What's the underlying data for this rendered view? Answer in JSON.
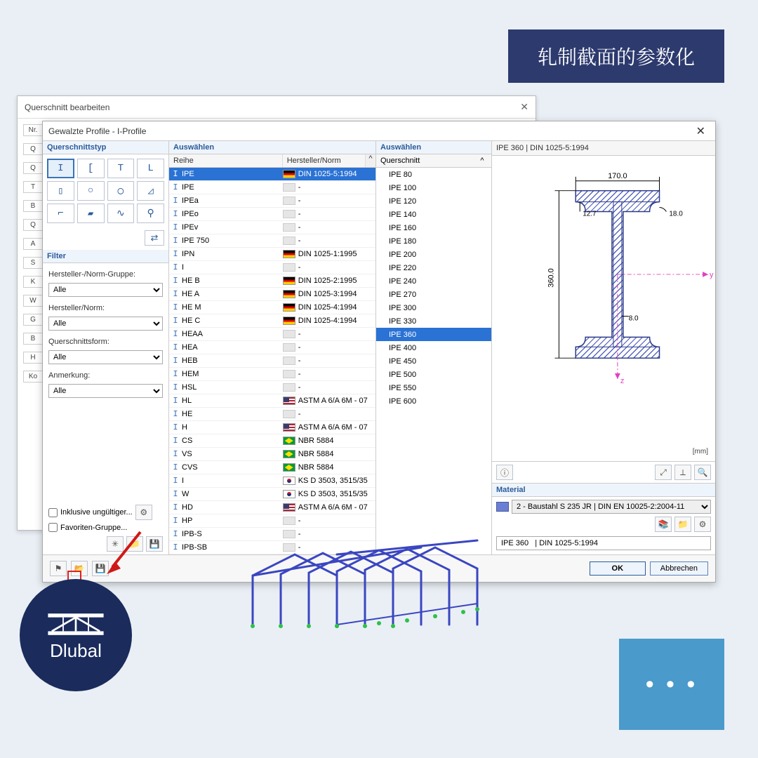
{
  "banner": {
    "text": "轧制截面的参数化"
  },
  "dialog1": {
    "title": "Querschnitt bearbeiten",
    "stubs": [
      "Nr.",
      "Q",
      "Q",
      "T",
      "B",
      "Q",
      "A",
      "S",
      "K",
      "W",
      "G",
      "B",
      "H",
      "Ko"
    ]
  },
  "dialog2": {
    "title": "Gewalzte Profile - I-Profile",
    "left": {
      "type_label": "Querschnittstyp",
      "types": [
        "I",
        "[",
        "T",
        "L",
        "▯",
        "○",
        "◯",
        "◿",
        "⌐",
        "▰",
        "∿",
        "⚲"
      ],
      "filter_label": "Filter",
      "f1_label": "Hersteller-/Norm-Gruppe:",
      "f2_label": "Hersteller/Norm:",
      "f3_label": "Querschnittsform:",
      "f4_label": "Anmerkung:",
      "alle": "Alle",
      "chk1": "Inklusive ungültiger...",
      "chk2": "Favoriten-Gruppe..."
    },
    "series": {
      "label": "Auswählen",
      "h1": "Reihe",
      "h2": "Hersteller/Norm",
      "rows": [
        {
          "n": "IPE",
          "flag": "de",
          "norm": "DIN 1025-5:1994",
          "sel": true
        },
        {
          "n": "IPE",
          "flag": "none",
          "norm": "-"
        },
        {
          "n": "IPEa",
          "flag": "none",
          "norm": "-"
        },
        {
          "n": "IPEo",
          "flag": "none",
          "norm": "-"
        },
        {
          "n": "IPEv",
          "flag": "none",
          "norm": "-"
        },
        {
          "n": "IPE 750",
          "flag": "none",
          "norm": "-"
        },
        {
          "n": "IPN",
          "flag": "de",
          "norm": "DIN 1025-1:1995"
        },
        {
          "n": "I",
          "flag": "none",
          "norm": "-"
        },
        {
          "n": "HE B",
          "flag": "de",
          "norm": "DIN 1025-2:1995"
        },
        {
          "n": "HE A",
          "flag": "de",
          "norm": "DIN 1025-3:1994"
        },
        {
          "n": "HE M",
          "flag": "de",
          "norm": "DIN 1025-4:1994"
        },
        {
          "n": "HE C",
          "flag": "de",
          "norm": "DIN 1025-4:1994"
        },
        {
          "n": "HEAA",
          "flag": "none",
          "norm": "-"
        },
        {
          "n": "HEA",
          "flag": "none",
          "norm": "-"
        },
        {
          "n": "HEB",
          "flag": "none",
          "norm": "-"
        },
        {
          "n": "HEM",
          "flag": "none",
          "norm": "-"
        },
        {
          "n": "HSL",
          "flag": "none",
          "norm": "-"
        },
        {
          "n": "HL",
          "flag": "us",
          "norm": "ASTM A 6/A 6M - 07"
        },
        {
          "n": "HE",
          "flag": "none",
          "norm": "-"
        },
        {
          "n": "H",
          "flag": "us",
          "norm": "ASTM A 6/A 6M - 07"
        },
        {
          "n": "CS",
          "flag": "br",
          "norm": "NBR 5884"
        },
        {
          "n": "VS",
          "flag": "br",
          "norm": "NBR 5884"
        },
        {
          "n": "CVS",
          "flag": "br",
          "norm": "NBR 5884"
        },
        {
          "n": "I",
          "flag": "kr",
          "norm": "KS D 3503, 3515/35"
        },
        {
          "n": "W",
          "flag": "kr",
          "norm": "KS D 3503, 3515/35"
        },
        {
          "n": "HD",
          "flag": "us",
          "norm": "ASTM A 6/A 6M - 07"
        },
        {
          "n": "HP",
          "flag": "none",
          "norm": "-"
        },
        {
          "n": "IPB-S",
          "flag": "none",
          "norm": "-"
        },
        {
          "n": "IPB-SB",
          "flag": "none",
          "norm": "-"
        }
      ]
    },
    "sizes": {
      "label": "Auswählen",
      "head": "Querschnitt",
      "rows": [
        "IPE 80",
        "IPE 100",
        "IPE 120",
        "IPE 140",
        "IPE 160",
        "IPE 180",
        "IPE 200",
        "IPE 220",
        "IPE 240",
        "IPE 270",
        "IPE 300",
        "IPE 330",
        "IPE 360",
        "IPE 400",
        "IPE 450",
        "IPE 500",
        "IPE 550",
        "IPE 600"
      ],
      "selected": "IPE 360"
    },
    "preview": {
      "title": "IPE 360 | DIN 1025-5:1994",
      "width": "170.0",
      "height": "360.0",
      "tf": "12.7",
      "r": "18.0",
      "tw": "8.0",
      "unit": "[mm]"
    },
    "material": {
      "label": "Material",
      "value": "2 - Baustahl S 235 JR   | DIN EN 10025-2:2004-11"
    },
    "readout": "IPE 360   | DIN 1025-5:1994",
    "footer": {
      "ok": "OK",
      "cancel": "Abbrechen"
    }
  },
  "logo": {
    "text": "Dlubal"
  },
  "dots": {
    "text": "• • •"
  }
}
